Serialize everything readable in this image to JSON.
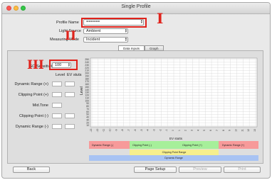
{
  "window": {
    "title": "Single Profile"
  },
  "form": {
    "profile_name_label": "Profile Name",
    "profile_name_value": "======",
    "light_source_label": "Light Source",
    "light_source_value": "Ambient",
    "measuring_mode_label": "Measuring Mode",
    "measuring_mode_value": "Incident"
  },
  "annotations": {
    "marker_1": "I",
    "marker_2": "II",
    "marker_3": "III"
  },
  "tabs": [
    {
      "label": "Data Inputs",
      "active": true
    },
    {
      "label": "Graph",
      "active": false
    }
  ],
  "left_panel": {
    "iso_label": "ISO Sensitivity",
    "iso_value": "100",
    "col_level": "Level",
    "col_ev": "EV stuts",
    "rows": [
      {
        "label": "Dynamic Range (+)"
      },
      {
        "label": "Clipping Point (+)"
      },
      {
        "label": "Mid.Tone"
      },
      {
        "label": "Clipping Point (-)"
      },
      {
        "label": "Dynamic Range (-)"
      }
    ]
  },
  "chart_data": {
    "type": "line",
    "ylabel": "Level",
    "xlabel": "EV stutts",
    "yticks": [
      "250",
      "240",
      "230",
      "220",
      "210",
      "200",
      "190",
      "180",
      "170",
      "160",
      "150",
      "140",
      "130",
      "120",
      "110",
      "100",
      "90",
      "80",
      "70",
      "60",
      "50",
      "40",
      "30",
      "20",
      "10"
    ],
    "xticks": [
      "-13",
      "-12",
      "-11",
      "-10",
      "-9",
      "-8",
      "-7",
      "-6",
      "-5",
      "-4",
      "-3",
      "-2",
      "-1",
      "0",
      "1",
      "2",
      "3",
      "4",
      "5",
      "6",
      "7",
      "8",
      "9",
      "10",
      "11",
      "12",
      "13"
    ],
    "grid": true,
    "series": []
  },
  "range_bars": {
    "top": [
      {
        "label": "Dynamic Range (-)",
        "color": "#f79a9a"
      },
      {
        "label": "Clipping Point (-)",
        "color": "#a6ef9a"
      },
      {
        "label": "Clipping Point (+)",
        "color": "#a6ef9a"
      },
      {
        "label": "Dynamic Range (+)",
        "color": "#f79a9a"
      }
    ],
    "middle": {
      "label": "Clipping Point Range",
      "color": "#f6ef8e"
    },
    "bottom": {
      "label": "Dynamic Range",
      "color": "#a8c3f3"
    }
  },
  "footer": {
    "back_label": "Back",
    "page_setup_label": "Page Setup",
    "preview_label": "Preview",
    "print_label": "Print"
  }
}
